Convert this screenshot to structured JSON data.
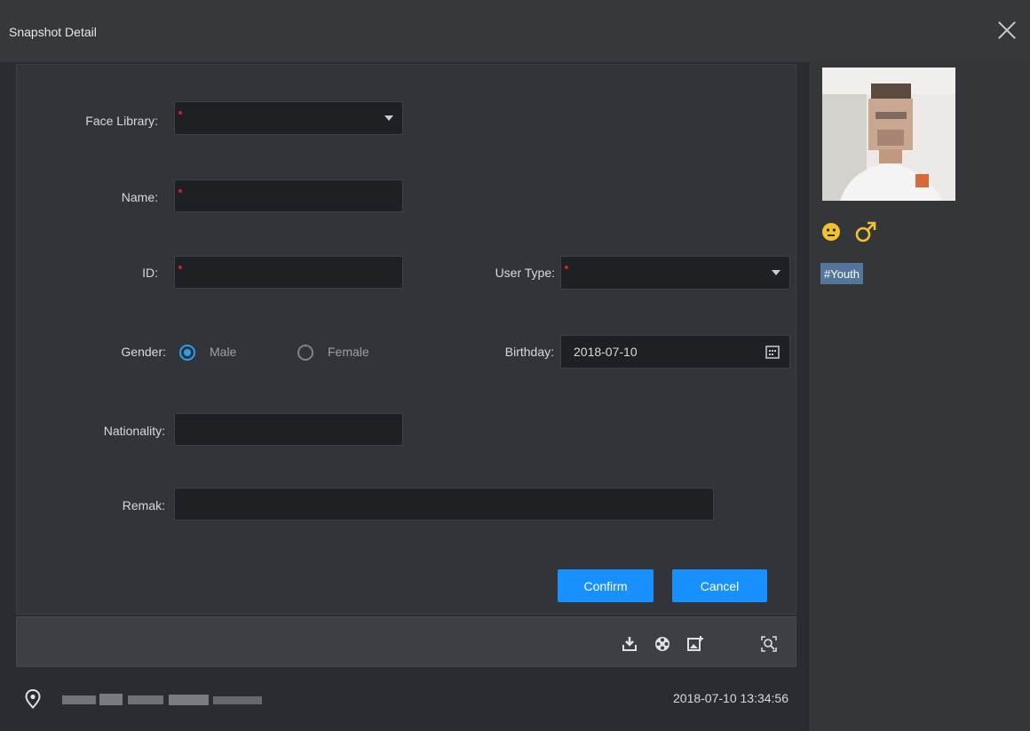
{
  "window": {
    "title": "Snapshot Detail"
  },
  "form": {
    "face_library": {
      "label": "Face Library:",
      "value": ""
    },
    "name": {
      "label": "Name:",
      "value": ""
    },
    "id": {
      "label": "ID:",
      "value": ""
    },
    "user_type": {
      "label": "User Type:",
      "value": ""
    },
    "gender": {
      "label": "Gender:",
      "male": "Male",
      "female": "Female",
      "selected": "Male"
    },
    "birthday": {
      "label": "Birthday:",
      "value": "2018-07-10"
    },
    "nationality": {
      "label": "Nationality:",
      "value": ""
    },
    "remark": {
      "label": "Remak:",
      "value": ""
    }
  },
  "buttons": {
    "confirm": "Confirm",
    "cancel": "Cancel"
  },
  "toolbar": {
    "icons": [
      "download-icon",
      "video-icon",
      "add-image-icon",
      "face-search-icon"
    ]
  },
  "footer": {
    "timestamp": "2018-07-10 13:34:56"
  },
  "attributes": {
    "tag": "#Youth",
    "expression_icon": "neutral-face-icon",
    "gender_icon": "male-icon"
  },
  "colors": {
    "accent": "#1890ff",
    "required": "#d21f1f",
    "tag_bg": "#53759b",
    "emoji": "#f2c12e"
  }
}
